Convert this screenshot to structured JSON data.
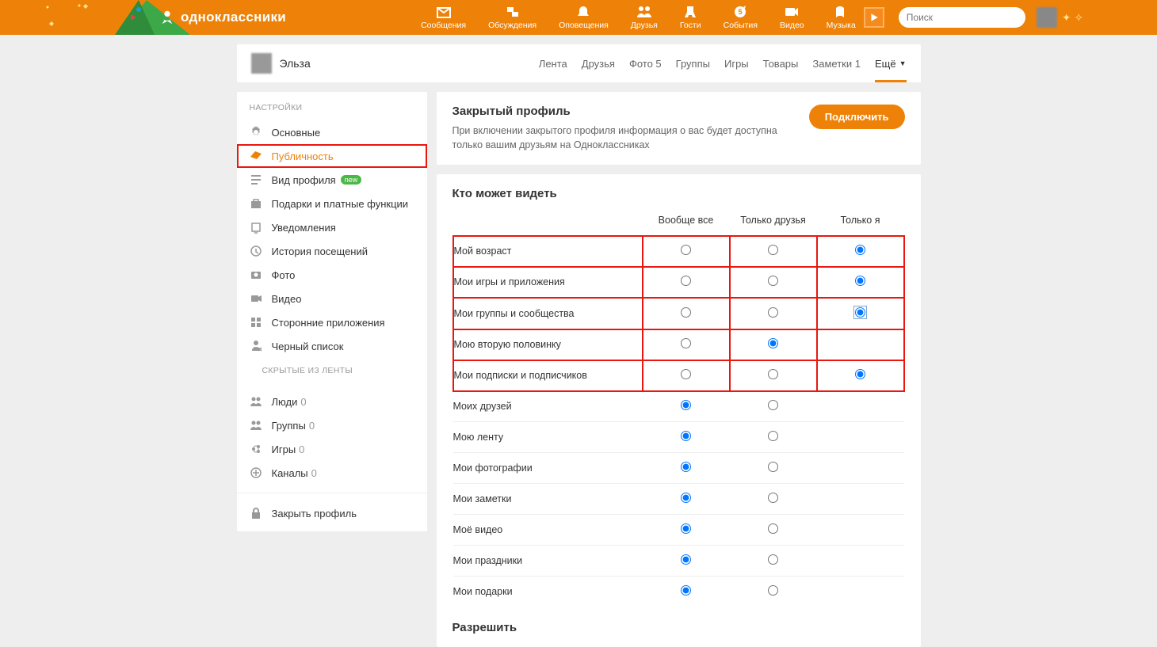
{
  "header": {
    "brand": "одноклассники",
    "nav": [
      {
        "label": "Сообщения"
      },
      {
        "label": "Обсуждения"
      },
      {
        "label": "Оповещения"
      },
      {
        "label": "Друзья"
      },
      {
        "label": "Гости"
      },
      {
        "label": "События"
      },
      {
        "label": "Видео"
      },
      {
        "label": "Музыка"
      }
    ],
    "search_placeholder": "Поиск"
  },
  "profile": {
    "name": "Эльза",
    "tabs": [
      {
        "label": "Лента"
      },
      {
        "label": "Друзья"
      },
      {
        "label": "Фото 5"
      },
      {
        "label": "Группы"
      },
      {
        "label": "Игры"
      },
      {
        "label": "Товары"
      },
      {
        "label": "Заметки 1"
      },
      {
        "label": "Ещё",
        "active": true,
        "caret": true
      }
    ]
  },
  "sidebar": {
    "settings_header": "НАСТРОЙКИ",
    "settings": [
      {
        "label": "Основные"
      },
      {
        "label": "Публичность",
        "active": true
      },
      {
        "label": "Вид профиля",
        "badge": "new"
      },
      {
        "label": "Подарки и платные функции"
      },
      {
        "label": "Уведомления"
      },
      {
        "label": "История посещений"
      },
      {
        "label": "Фото"
      },
      {
        "label": "Видео"
      },
      {
        "label": "Сторонние приложения"
      },
      {
        "label": "Черный список"
      }
    ],
    "hidden_header": "СКРЫТЫЕ ИЗ ЛЕНТЫ",
    "hidden": [
      {
        "label": "Люди",
        "count": "0"
      },
      {
        "label": "Группы",
        "count": "0"
      },
      {
        "label": "Игры",
        "count": "0"
      },
      {
        "label": "Каналы",
        "count": "0"
      }
    ],
    "close_profile": "Закрыть профиль"
  },
  "closed_card": {
    "title": "Закрытый профиль",
    "desc": "При включении закрытого профиля информация о вас будет доступна только вашим друзьям на Одноклассниках",
    "btn": "Подключить"
  },
  "visibility": {
    "title": "Кто может видеть",
    "cols": [
      "Вообще все",
      "Только друзья",
      "Только я"
    ],
    "rows": [
      {
        "label": "Мой возраст",
        "sel": 2,
        "box": true
      },
      {
        "label": "Мои игры и приложения",
        "sel": 2,
        "box": true
      },
      {
        "label": "Мои группы и сообщества",
        "sel": 2,
        "box": true,
        "focus": true
      },
      {
        "label": "Мою вторую половинку",
        "sel": 1,
        "box": true,
        "no_third": true
      },
      {
        "label": "Мои подписки и подписчиков",
        "sel": 2,
        "box": true
      },
      {
        "label": "Моих друзей",
        "sel": 0,
        "no_third": true
      },
      {
        "label": "Мою ленту",
        "sel": 0,
        "no_third": true
      },
      {
        "label": "Мои фотографии",
        "sel": 0,
        "no_third": true
      },
      {
        "label": "Мои заметки",
        "sel": 0,
        "no_third": true
      },
      {
        "label": "Моё видео",
        "sel": 0,
        "no_third": true
      },
      {
        "label": "Мои праздники",
        "sel": 0,
        "no_third": true
      },
      {
        "label": "Мои подарки",
        "sel": 0,
        "no_third": true
      }
    ],
    "allow_title": "Разрешить"
  }
}
